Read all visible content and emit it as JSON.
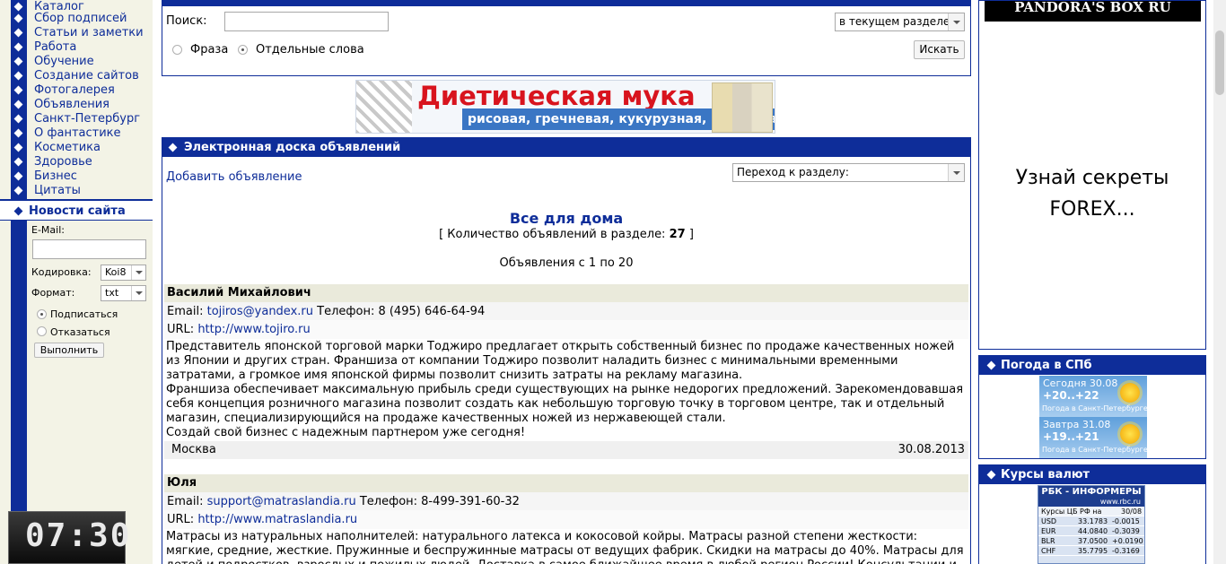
{
  "left": {
    "menu": [
      "Каталог",
      "Сбор подписей",
      "Статьи и заметки",
      "Работа",
      "Обучение",
      "Создание сайтов",
      "Фотогалерея",
      "Объявления",
      "Санкт-Петербург",
      "О фантастике",
      "Косметика",
      "Здоровье",
      "Бизнес",
      "Цитаты"
    ],
    "news_title": "Новости сайта",
    "email_label": "E-Mail:",
    "encoding_label": "Кодировка:",
    "encoding_value": "Koi8",
    "format_label": "Формат:",
    "format_value": "txt",
    "subscribe": "Подписаться",
    "unsubscribe": "Отказаться",
    "submit": "Выполнить",
    "clock": "07:30"
  },
  "search": {
    "label": "Поиск:",
    "scope": "в текущем разделе",
    "phrase": "Фраза",
    "words": "Отдельные слова",
    "button": "Искать"
  },
  "ad": {
    "title": "Диетическая мука",
    "subtitle": "рисовая, гречневая, кукурузная, гороховая..."
  },
  "board": {
    "title": "Электронная доска объявлений",
    "add": "Добавить объявление",
    "jump": "Переход к разделу:",
    "section": "Все для дома",
    "count_prefix": "[ Количество объявлений в разделе:",
    "count": "27",
    "count_suffix": "]",
    "range": "Объявления с 1 по 20",
    "listings": [
      {
        "name": "Василий Михайлович",
        "email_label": "Email:",
        "email": "tojiros@yandex.ru",
        "phone": "Телефон: 8 (495) 646-64-94",
        "url_label": "URL:",
        "url": "http://www.tojiro.ru",
        "text": [
          "Представитель японской торговой марки Тоджиро предлагает открыть собственный бизнес по продаже качественных ножей из Японии и других стран. Франшиза от компании Тоджиро позволит наладить бизнес с минимальными временными затратами, а громкое имя японской фирмы позволит снизить затраты на рекламу магазина.",
          "Франшиза обеспечивает максимальную прибыль среди существующих на рынке недорогих предложений. Зарекомендовавшая себя концепция розничного магазина позволит создать как небольшую торговую точку в торговом центре, так и отдельный магазин, специализирующийся на продаже качественных ножей из нержавеющей стали.",
          "Создай свой бизнес с надежным партнером уже сегодня!"
        ],
        "city": "Москва",
        "date": "30.08.2013"
      },
      {
        "name": "Юля",
        "email_label": "Email:",
        "email": "support@matraslandia.ru",
        "phone": "Телефон: 8-499-391-60-32",
        "url_label": "URL:",
        "url": "http://www.matraslandia.ru",
        "text": [
          "Матрасы из натуральных наполнителей: натурального латекса и кокосовой койры. Матрасы разной степени жесткости: мягкие, средние, жесткие. Пружинные и беспружинные матрасы от ведущих фабрик. Скидки на матрасы до 40%. Матрасы для детей и подростков, взрослых и пожилых людей. Доставка в самое ближайшее время в любой регион России! Консультации и заказ."
        ]
      }
    ]
  },
  "right": {
    "top_banner": "PANDORA'S BOX RU",
    "forex": [
      "Узнай секреты",
      "FOREX..."
    ],
    "weather_title": "Погода в СПб",
    "weather": [
      {
        "day": "Сегодня 30.08",
        "temp": "+20..+22",
        "city": "Погода в Санкт-Петербурге"
      },
      {
        "day": "Завтра 31.08",
        "temp": "+19..+21",
        "city": "Погода в Санкт-Петербурге"
      }
    ],
    "currency_title": "Курсы валют",
    "currency": {
      "head": "РБК - ИНФОРМЕРЫ",
      "site": "www.rbc.ru",
      "sub": "Курсы ЦБ РФ на",
      "sub_date": "30/08",
      "rows": [
        {
          "code": "USD",
          "rate": "33.1783",
          "change": "-0.0015"
        },
        {
          "code": "EUR",
          "rate": "44.0840",
          "change": "-0.3039"
        },
        {
          "code": "BLR",
          "rate": "37.0500",
          "change": "+0.0190"
        },
        {
          "code": "CHF",
          "rate": "35.7795",
          "change": "-0.3169"
        }
      ]
    }
  }
}
